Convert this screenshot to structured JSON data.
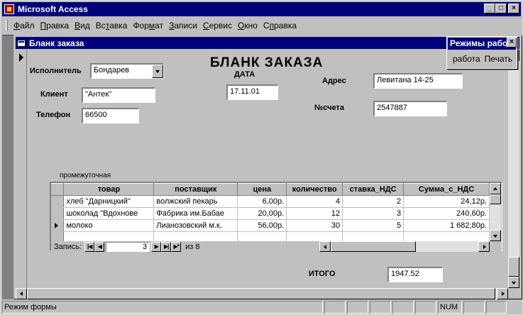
{
  "window": {
    "title": "Microsoft Access"
  },
  "menu": {
    "items": [
      {
        "u": "Ф",
        "rest": "айл"
      },
      {
        "u": "П",
        "rest": "равка"
      },
      {
        "u": "В",
        "rest": "ид"
      },
      {
        "pre": "Вс",
        "u": "т",
        "rest": "авка"
      },
      {
        "pre": "Фор",
        "u": "м",
        "rest": "ат"
      },
      {
        "u": "З",
        "rest": "аписи"
      },
      {
        "u": "С",
        "rest": "ервис"
      },
      {
        "u": "О",
        "rest": "кно"
      },
      {
        "pre": "С",
        "u": "п",
        "rest": "равка"
      }
    ]
  },
  "child": {
    "title": "Бланк заказа"
  },
  "form": {
    "heading": "БЛАНК   ЗАКАЗА",
    "executor_label": "Исполнитель",
    "executor_value": "Бондарев",
    "date_label": "ДАТА",
    "date_value": "17.11.01",
    "address_label": "Адрес",
    "address_value": "Левитана 14-25",
    "client_label": "Клиент",
    "client_value": "\"Антек\"",
    "phone_label": "Телефон",
    "phone_value": "66500",
    "invoice_label": "№счета",
    "invoice_value": "2547887",
    "subform_label": "промежуточная",
    "total_label": "ИТОГО",
    "total_value": "1947.52"
  },
  "grid": {
    "columns": [
      "товар",
      "поставщик",
      "цена",
      "количество",
      "ставка_НДС",
      "Сумма_с_НДС"
    ],
    "rows": [
      [
        "хлеб \"Дарницкий\"",
        "волжский пекарь",
        "6,00р.",
        "4",
        "2",
        "24,12р."
      ],
      [
        "шоколад \"Вдохнове",
        "Фабрика им.Бабае",
        "20,00р.",
        "12",
        "3",
        "240,60р."
      ],
      [
        "молоко",
        "Лианозовский м.к.",
        "56,00р.",
        "30",
        "5",
        "1 682,80р."
      ]
    ],
    "current_row": 2
  },
  "nav": {
    "label": "Запись:",
    "current": "3",
    "of_label": "из",
    "total": "8",
    "first": "|◀",
    "prev": "◀",
    "next": "▶",
    "last": "▶|",
    "new": "▶*"
  },
  "palette": {
    "title": "Режимы работы",
    "btn_work": "работа",
    "btn_print": "Печать"
  },
  "status": {
    "text": "Режим формы",
    "num": "NUM"
  },
  "colors": {
    "title_bar": "#00007b",
    "face": "#c0c0c0",
    "workspace": "#808080"
  }
}
